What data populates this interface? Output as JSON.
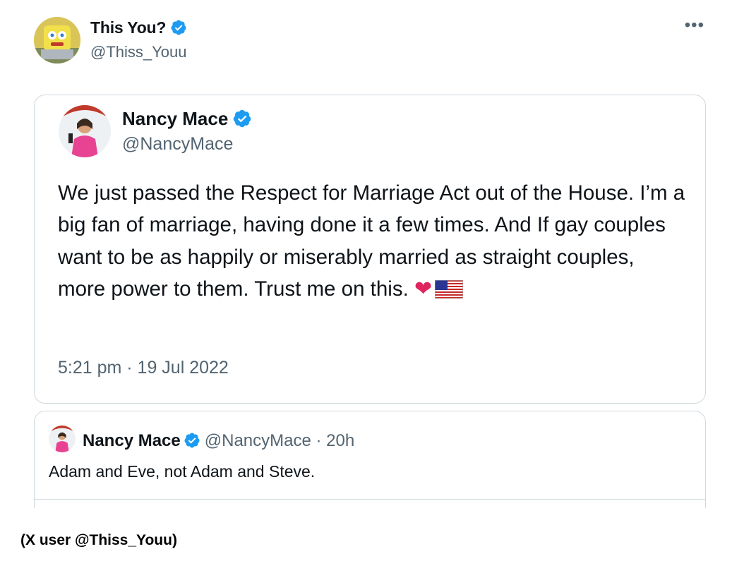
{
  "header": {
    "author_name": "This You?",
    "author_handle": "@Thiss_Youu",
    "more_icon": "more-horizontal-icon"
  },
  "quoted_tweet": {
    "author_name": "Nancy Mace",
    "author_handle": "@NancyMace",
    "text": "We just passed the Respect for Marriage Act out of the House. I’m a big fan of marriage, having done it a few times. And If gay couples want to be as happily or miserably married as straight couples, more power to them. Trust me on this.",
    "emoji": [
      "red-heart",
      "us-flag"
    ],
    "timestamp": "5:21 pm · 19 Jul 2022"
  },
  "second_tweet": {
    "author_name": "Nancy Mace",
    "author_handle": "@NancyMace",
    "separator": "·",
    "age": "20h",
    "text": "Adam and Eve, not Adam and Steve."
  },
  "caption": "(X user @Thiss_Youu)",
  "colors": {
    "verified_blue": "#1d9bf0",
    "secondary_text": "#536471",
    "border": "#cfd9de",
    "heart_red": "#e0245e"
  }
}
